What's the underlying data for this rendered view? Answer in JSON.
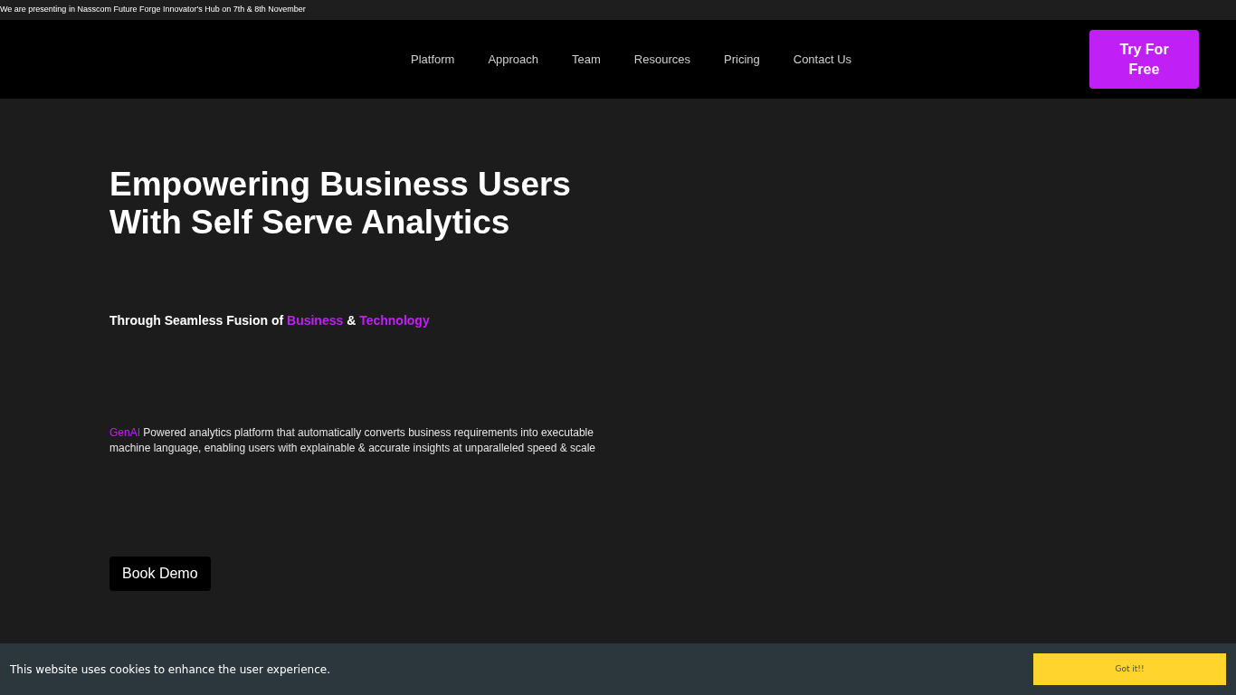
{
  "announcement": "We are presenting in Nasscom Future Forge Innovator's Hub on 7th & 8th November",
  "nav": {
    "links": [
      "Platform",
      "Approach",
      "Team",
      "Resources",
      "Pricing",
      "Contact Us"
    ],
    "cta": "Try For Free"
  },
  "hero": {
    "title": "Empowering Business Users With Self Serve Analytics",
    "subtitle": [
      {
        "text": "Through Seamless Fusion of ",
        "highlight": false
      },
      {
        "text": "Business",
        "highlight": true
      },
      {
        "text": " & ",
        "highlight": false
      },
      {
        "text": "Technology",
        "highlight": true
      }
    ],
    "description": [
      {
        "text": "GenAI",
        "highlight": true
      },
      {
        "text": " Powered analytics platform that automatically converts business requirements into executable machine language, enabling users with explainable & accurate insights at unparalleled speed & scale",
        "highlight": false
      }
    ],
    "button": "Book Demo"
  },
  "cookie_banner": {
    "message": "This website uses cookies to enhance the user experience.",
    "button": "Got it!!"
  }
}
